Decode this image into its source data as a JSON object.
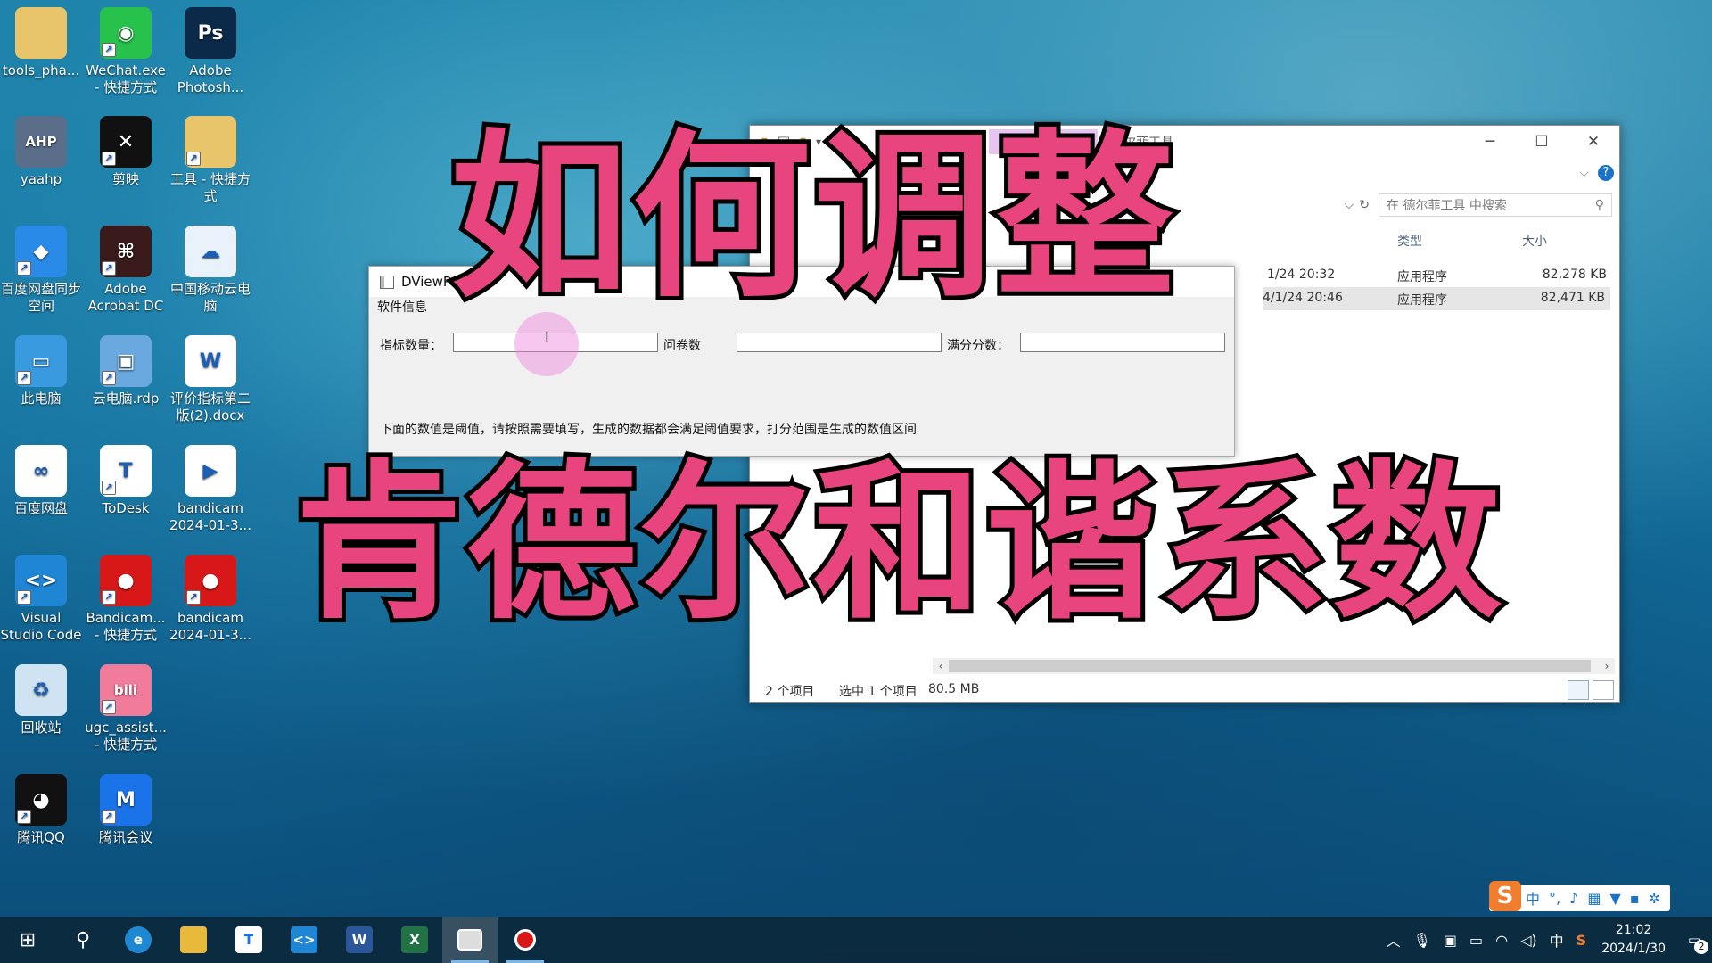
{
  "desktop": {
    "icons": [
      {
        "label": "tools_pha...",
        "icon": "folder-icon",
        "color": "#e8c56a"
      },
      {
        "label": "WeChat.exe - 快捷方式",
        "icon": "wechat-icon",
        "color": "#27c24c"
      },
      {
        "label": "Adobe Photosh...",
        "icon": "photoshop-icon",
        "color": "#0b2a4a"
      },
      {
        "label": "yaahp",
        "icon": "ahp-icon",
        "color": "#5a6e8a"
      },
      {
        "label": "剪映",
        "icon": "capcut-icon",
        "color": "#111111"
      },
      {
        "label": "工具 - 快捷方式",
        "icon": "folder-icon",
        "color": "#e8c56a"
      },
      {
        "label": "百度网盘同步空间",
        "icon": "baidu-sync-icon",
        "color": "#2a8ae8"
      },
      {
        "label": "Adobe Acrobat DC",
        "icon": "acrobat-icon",
        "color": "#3a1a1a"
      },
      {
        "label": "中国移动云电脑",
        "icon": "cloud-pc-icon",
        "color": "#e9f2fb"
      },
      {
        "label": "此电脑",
        "icon": "computer-icon",
        "color": "#3a9ae0"
      },
      {
        "label": "云电脑.rdp",
        "icon": "rdp-icon",
        "color": "#6aa8e0"
      },
      {
        "label": "评价指标第二版(2).docx",
        "icon": "word-doc-icon",
        "color": "#ffffff"
      },
      {
        "label": "百度网盘",
        "icon": "baidu-netdisk-icon",
        "color": "#ffffff"
      },
      {
        "label": "ToDesk",
        "icon": "todesk-icon",
        "color": "#ffffff"
      },
      {
        "label": "bandicam 2024-01-3...",
        "icon": "video-file-icon",
        "color": "#ffffff"
      },
      {
        "label": "Visual Studio Code",
        "icon": "vscode-icon",
        "color": "#1f86d6"
      },
      {
        "label": "Bandicam... - 快捷方式",
        "icon": "bandicam-icon",
        "color": "#d81818"
      },
      {
        "label": "bandicam 2024-01-3...",
        "icon": "bandicam-settings-icon",
        "color": "#d81818"
      },
      {
        "label": "回收站",
        "icon": "recycle-bin-icon",
        "color": "#cfe3f2"
      },
      {
        "label": "ugc_assist... - 快捷方式",
        "icon": "bilibili-icon",
        "color": "#f07b9b"
      },
      {
        "label": "腾讯QQ",
        "icon": "qq-icon",
        "color": "#111111"
      },
      {
        "label": "腾讯会议",
        "icon": "tencent-meeting-icon",
        "color": "#1a73e8"
      }
    ]
  },
  "explorer": {
    "context_tab": "管理",
    "context_label": "德尔菲工具",
    "search_placeholder": "在 德尔菲工具 中搜索",
    "columns": {
      "type": "类型",
      "size": "大小"
    },
    "rows": [
      {
        "date": "1/24 20:32",
        "type": "应用程序",
        "size": "82,278 KB",
        "selected": false
      },
      {
        "date": "4/1/24 20:46",
        "type": "应用程序",
        "size": "82,471 KB",
        "selected": true
      }
    ],
    "status": {
      "count": "2 个项目",
      "selected": "选中 1 个项目",
      "size": "80.5 MB"
    }
  },
  "dviewpro": {
    "title": "DViewPro",
    "menu": "软件信息",
    "fields": [
      {
        "label": "指标数量：",
        "value": ""
      },
      {
        "label": "问卷数",
        "value": ""
      },
      {
        "label": "满分分数：",
        "value": ""
      }
    ],
    "note": "下面的数值是阈值，请按照需要填写，生成的数据都会满足阈值要求，打分范围是生成的数值区间"
  },
  "overlay": {
    "line1": "如何调整",
    "line2": "肯德尔和谐系数"
  },
  "taskbar": {
    "apps": [
      "start-icon",
      "search-icon",
      "edge-icon",
      "file-explorer-icon",
      "todesk-icon",
      "vscode-icon",
      "word-icon",
      "excel-icon",
      "dviewpro-icon",
      "bandicam-icon"
    ],
    "ime": "中",
    "time": "21:02",
    "date": "2024/1/30",
    "notifications": "2"
  },
  "colors": {
    "caption_fill": "#e8457f",
    "caption_stroke": "#000000",
    "taskbar_bg": "#0c283c"
  }
}
